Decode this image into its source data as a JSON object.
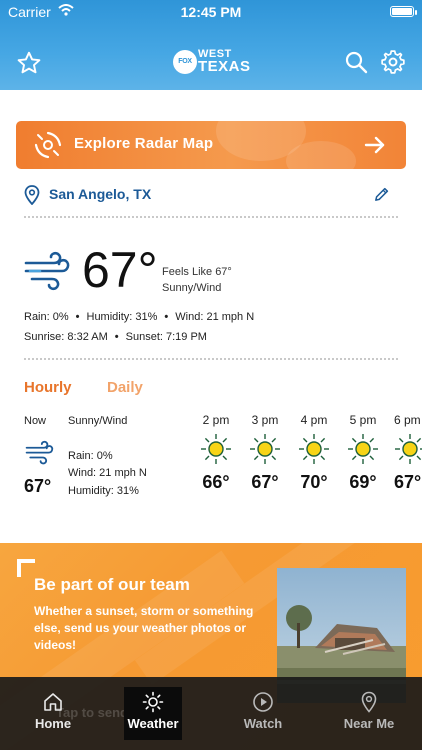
{
  "status_bar": {
    "carrier": "Carrier",
    "time": "12:45 PM"
  },
  "header": {
    "logo": {
      "fox": "FOX",
      "west": "WEST",
      "texas": "TEXAS"
    },
    "icons": [
      "star-icon",
      "search-icon",
      "gear-icon"
    ]
  },
  "radar": {
    "label": "Explore Radar Map"
  },
  "location": {
    "name": "San Angelo, TX"
  },
  "current": {
    "temp": "67°",
    "feels_like": "Feels Like 67°",
    "condition": "Sunny/Wind",
    "rain": "Rain: 0%",
    "humidity": "Humidity: 31%",
    "wind": "Wind: 21 mph N",
    "sunrise": "Sunrise: 8:32 AM",
    "sunset": "Sunset: 7:19 PM",
    "separator": "•"
  },
  "tabs": {
    "hourly": "Hourly",
    "daily": "Daily"
  },
  "now": {
    "label": "Now",
    "condition": "Sunny/Wind",
    "temp": "67°",
    "rain": "Rain: 0%",
    "wind": "Wind: 21 mph N",
    "humidity": "Humidity: 31%"
  },
  "hourly": [
    {
      "time": "2 pm",
      "temp": "66°"
    },
    {
      "time": "3 pm",
      "temp": "67°"
    },
    {
      "time": "4 pm",
      "temp": "70°"
    },
    {
      "time": "5 pm",
      "temp": "69°"
    },
    {
      "time": "6 pm",
      "temp": "67°"
    }
  ],
  "promo": {
    "title": "Be part of our team",
    "body": "Whether a sunset, storm or something else, send us your weather photos or videos!",
    "ghost_text": "Tap to send"
  },
  "tabbar": {
    "home": "Home",
    "weather": "Weather",
    "watch": "Watch",
    "near_me": "Near Me"
  },
  "colors": {
    "header_blue": "#2f95d8",
    "accent_orange": "#f07d2f",
    "location_blue": "#1c5a97",
    "sun_yellow": "#f7d417",
    "promo_orange": "#f69a33"
  }
}
